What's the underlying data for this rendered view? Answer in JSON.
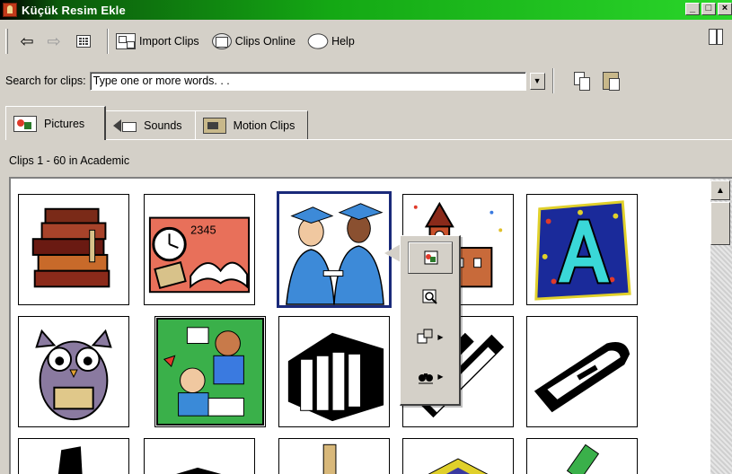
{
  "window": {
    "title": "Küçük Resim Ekle",
    "controls": {
      "minimize": "_",
      "maximize": "□",
      "close": "×"
    }
  },
  "toolbar": {
    "back_icon": "back-arrow-icon",
    "forward_icon": "forward-arrow-icon",
    "import_label": "Import Clips",
    "online_label": "Clips Online",
    "help_label": "Help"
  },
  "search": {
    "label": "Search for clips:",
    "value": "Type one or more words. . ."
  },
  "tabs": [
    {
      "label": "Pictures",
      "icon": "pictures-icon",
      "active": true
    },
    {
      "label": "Sounds",
      "icon": "sounds-icon",
      "active": false
    },
    {
      "label": "Motion Clips",
      "icon": "motion-clips-icon",
      "active": false
    }
  ],
  "status": {
    "text": "Clips 1 - 60 in Academic"
  },
  "clips": [
    {
      "name": "books-stack",
      "selected": false
    },
    {
      "name": "clock-book",
      "selected": false
    },
    {
      "name": "graduates",
      "selected": true
    },
    {
      "name": "school-building",
      "selected": false
    },
    {
      "name": "letter-a",
      "selected": false
    },
    {
      "name": "owl-reading",
      "selected": false
    },
    {
      "name": "children-studying",
      "selected": false
    },
    {
      "name": "binders",
      "selected": false
    },
    {
      "name": "pens",
      "selected": false
    },
    {
      "name": "stapler",
      "selected": false
    }
  ],
  "popup_menu": [
    {
      "icon": "insert-clip-icon"
    },
    {
      "icon": "preview-clip-icon"
    },
    {
      "icon": "add-to-category-icon"
    },
    {
      "icon": "find-similar-icon"
    }
  ],
  "colors": {
    "title_gradient_start": "#000000",
    "title_gradient_end": "#2ad62a",
    "selection_border": "#1a2a7a",
    "chrome": "#d4d0c8"
  }
}
